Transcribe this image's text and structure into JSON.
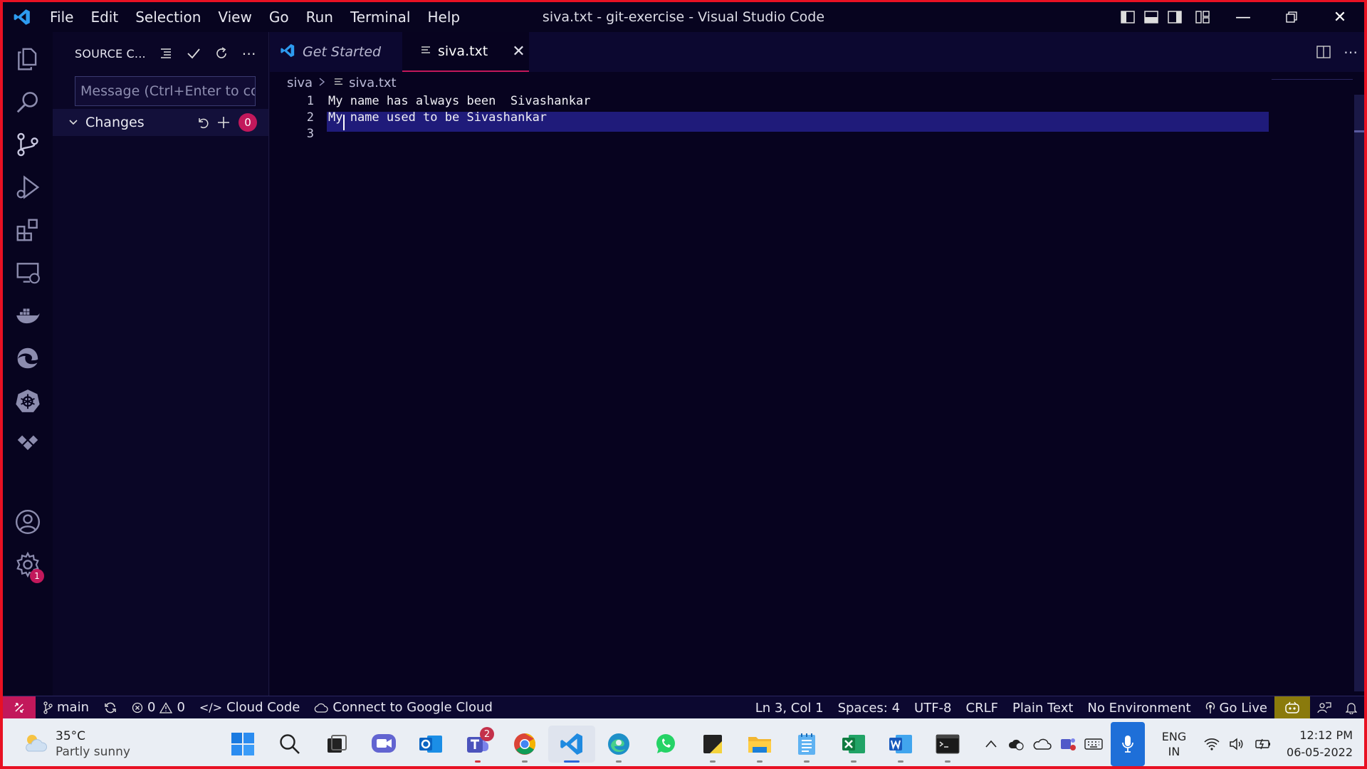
{
  "window": {
    "title": "siva.txt - git-exercise - Visual Studio Code",
    "menu": [
      "File",
      "Edit",
      "Selection",
      "View",
      "Go",
      "Run",
      "Terminal",
      "Help"
    ]
  },
  "activity_bar": {
    "items": [
      "explorer-icon",
      "search-icon",
      "source-control-icon",
      "run-debug-icon",
      "extensions-icon",
      "remote-explorer-icon",
      "docker-icon",
      "edge-devtools-icon",
      "kubernetes-icon",
      "cloud-code-icon"
    ],
    "settings_badge": "1"
  },
  "sidebar": {
    "title": "SOURCE C...",
    "message_placeholder": "Message (Ctrl+Enter to co...",
    "changes_label": "Changes",
    "changes_count": "0"
  },
  "tabs": [
    {
      "label": "Get Started",
      "active": false
    },
    {
      "label": "siva.txt",
      "active": true
    }
  ],
  "breadcrumb": {
    "folder": "siva",
    "file": "siva.txt"
  },
  "editor": {
    "lines": [
      {
        "num": "1",
        "text": "My name has always been  Sivashankar"
      },
      {
        "num": "2",
        "text": "My name used to be Sivashankar"
      },
      {
        "num": "3",
        "text": ""
      }
    ]
  },
  "status_bar": {
    "branch": "main",
    "errors": "0",
    "warnings": "0",
    "cloud_code": "Cloud Code",
    "google_cloud": "Connect to Google Cloud",
    "position": "Ln 3, Col 1",
    "spaces": "Spaces: 4",
    "encoding": "UTF-8",
    "eol": "CRLF",
    "language": "Plain Text",
    "environment": "No Environment",
    "go_live": "Go Live"
  },
  "taskbar": {
    "weather_temp": "35°C",
    "weather_desc": "Partly sunny",
    "teams_badge": "2",
    "lang_top": "ENG",
    "lang_bottom": "IN",
    "time": "12:12 PM",
    "date": "06-05-2022"
  },
  "colors": {
    "accent": "#c2185b",
    "editor_bg": "#07031f",
    "line_highlight": "#1f1b7a"
  }
}
